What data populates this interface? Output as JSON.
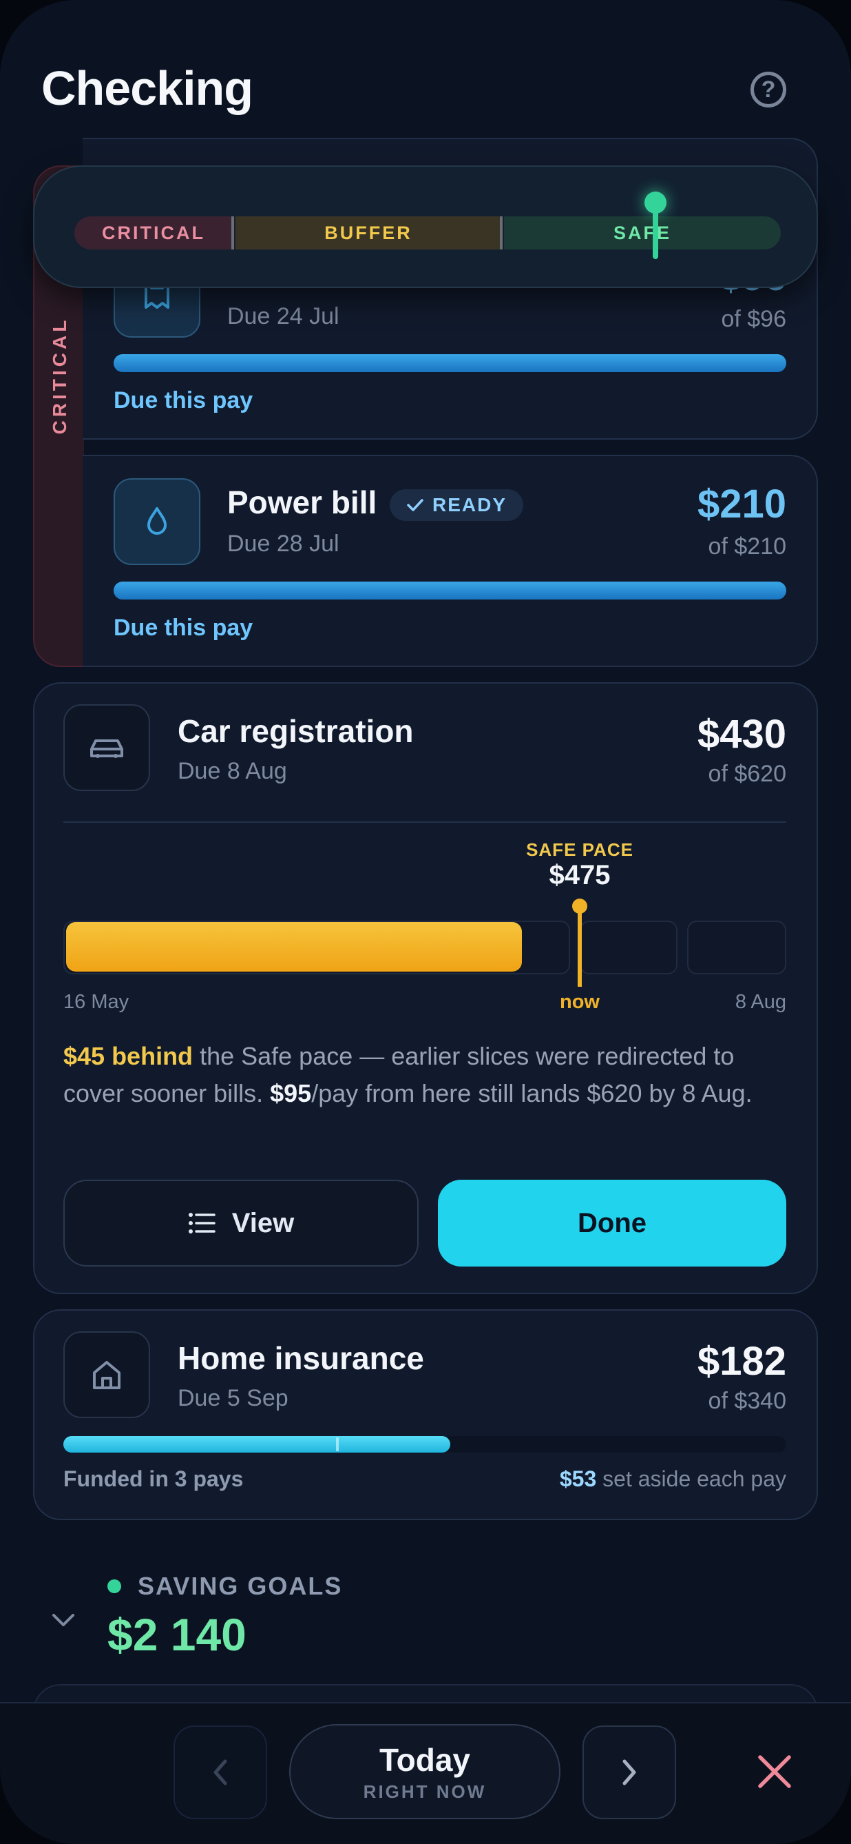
{
  "header": {
    "title": "Checking",
    "help_icon": "help-circle-icon"
  },
  "meter": {
    "segments": [
      "CRITICAL",
      "BUFFER",
      "SAFE"
    ],
    "colors": {
      "critical": "#e98fa0",
      "buffer": "#f2c94c",
      "safe": "#34d399"
    },
    "current_segment": "SAFE"
  },
  "critical_group": {
    "label": "CRITICAL",
    "items": [
      {
        "icon": "receipt-icon",
        "due": "Due 24 Jul",
        "amount": "$96",
        "of": "of $96",
        "footer": "Due this pay",
        "progress": 1.0
      },
      {
        "icon": "water-drop-icon",
        "name": "Power bill",
        "badge": "READY",
        "due": "Due 28 Jul",
        "amount": "$210",
        "of": "of $210",
        "footer": "Due this pay",
        "progress": 1.0
      }
    ]
  },
  "car_registration": {
    "icon": "car-icon",
    "name": "Car registration",
    "due": "Due 8 Aug",
    "amount": "$430",
    "of": "of $620",
    "safe_pace_label": "SAFE PACE",
    "safe_pace_value": "$475",
    "axis_start": "16 May",
    "axis_now": "now",
    "axis_end": "8 Aug",
    "behind": "$45 behind",
    "text1": " the Safe pace — earlier slices were redirected to cover sooner bills. ",
    "per_pay": "$95",
    "text2": "/pay from here still lands $620 by 8 Aug.",
    "view_label": "View",
    "done_label": "Done",
    "progress": 0.694
  },
  "home_insurance": {
    "icon": "home-icon",
    "name": "Home insurance",
    "due": "Due 5 Sep",
    "amount": "$182",
    "of": "of $340",
    "funded": "Funded in 3 pays",
    "aside_amount": "$53",
    "aside_text": " set aside each pay",
    "progress": 0.535
  },
  "saving_goals": {
    "label": "SAVING GOALS",
    "amount": "$2 140"
  },
  "bottom": {
    "today": "Today",
    "today_sub": "RIGHT NOW"
  }
}
